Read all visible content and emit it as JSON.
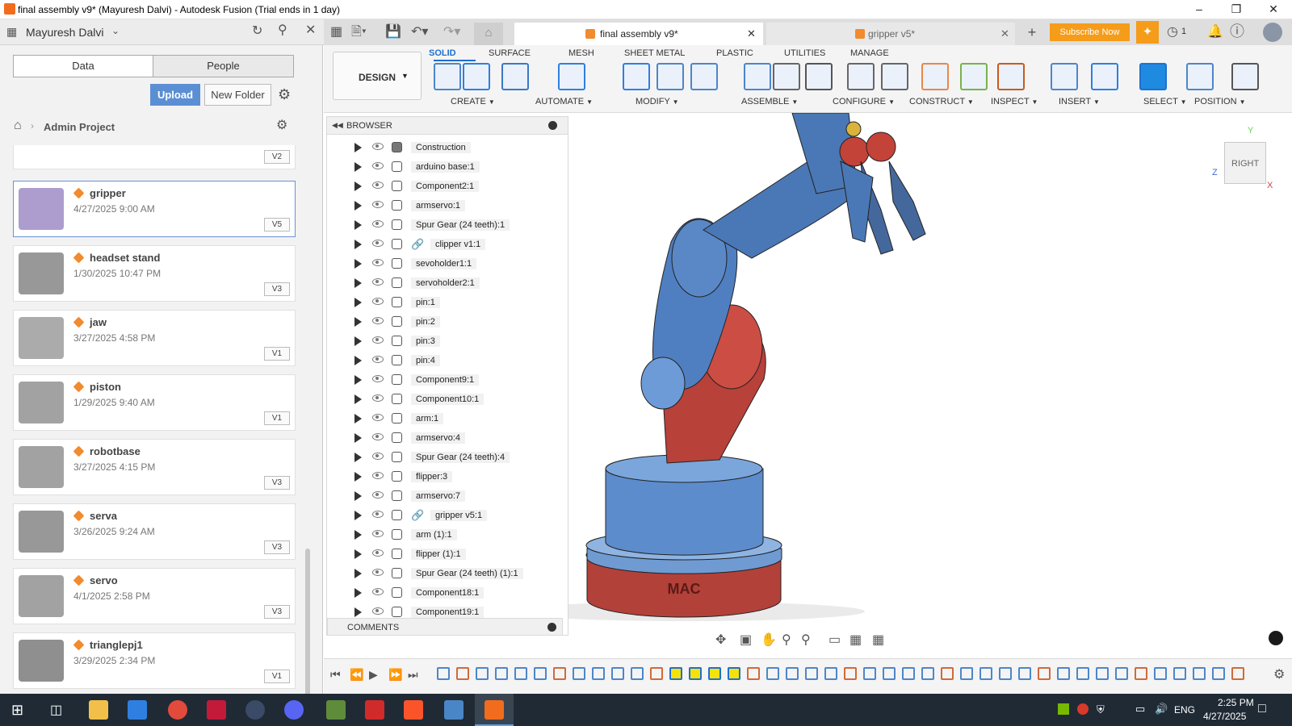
{
  "window": {
    "title": "final assembly v9* (Mayuresh Dalvi) - Autodesk Fusion (Trial ends in 1 day)"
  },
  "appbar": {
    "user": "Mayuresh Dalvi"
  },
  "data_panel": {
    "tabs": [
      "Data",
      "People"
    ],
    "upload_label": "Upload",
    "new_folder_label": "New Folder",
    "breadcrumb": "Admin Project",
    "partial_version": "V2",
    "items": [
      {
        "name": "gripper",
        "date": "4/27/2025 9:00 AM",
        "version": "V5"
      },
      {
        "name": "headset stand",
        "date": "1/30/2025 10:47 PM",
        "version": "V3"
      },
      {
        "name": "jaw",
        "date": "3/27/2025 4:58 PM",
        "version": "V1"
      },
      {
        "name": "piston",
        "date": "1/29/2025 9:40 AM",
        "version": "V1"
      },
      {
        "name": "robotbase",
        "date": "3/27/2025 4:15 PM",
        "version": "V3"
      },
      {
        "name": "serva",
        "date": "3/26/2025 9:24 AM",
        "version": "V3"
      },
      {
        "name": "servo",
        "date": "4/1/2025 2:58 PM",
        "version": "V3"
      },
      {
        "name": "trianglepj1",
        "date": "3/29/2025 2:34 PM",
        "version": "V1"
      }
    ]
  },
  "doc_tabs": [
    {
      "label": "final assembly v9*"
    },
    {
      "label": "gripper v5*"
    }
  ],
  "subscribe_label": "Subscribe Now",
  "jobs_count": "1",
  "toolbar": {
    "workspace": "DESIGN",
    "tabs": [
      "SOLID",
      "SURFACE",
      "MESH",
      "SHEET METAL",
      "PLASTIC",
      "UTILITIES",
      "MANAGE"
    ],
    "groups": [
      "CREATE",
      "AUTOMATE",
      "MODIFY",
      "ASSEMBLE",
      "CONFIGURE",
      "CONSTRUCT",
      "INSPECT",
      "INSERT",
      "SELECT",
      "POSITION"
    ]
  },
  "browser": {
    "title": "BROWSER",
    "items": [
      "Construction",
      "arduino base:1",
      "Component2:1",
      "armservo:1",
      "Spur Gear (24 teeth):1",
      "clipper v1:1",
      "sevoholder1:1",
      "servoholder2:1",
      "pin:1",
      "pin:2",
      "pin:3",
      "pin:4",
      "Component9:1",
      "Component10:1",
      "arm:1",
      "armservo:4",
      "Spur Gear (24 teeth):4",
      "flipper:3",
      "armservo:7",
      "gripper v5:1",
      "arm (1):1",
      "flipper (1):1",
      "Spur Gear (24 teeth) (1):1",
      "Component18:1",
      "Component19:1"
    ],
    "comments": "COMMENTS"
  },
  "viewcube": {
    "face": "RIGHT",
    "axis_y": "Y",
    "axis_z": "Z",
    "axis_x": "X"
  },
  "model": {
    "base_text": "MAC"
  },
  "taskbar": {
    "lang": "ENG",
    "time": "2:25 PM",
    "date": "4/27/2025"
  }
}
